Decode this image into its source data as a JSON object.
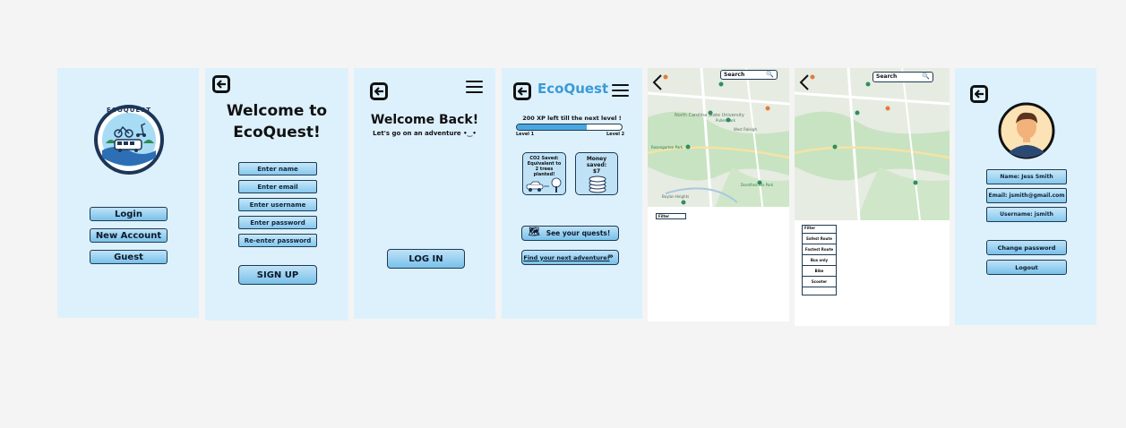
{
  "screen1": {
    "logo_text": "ECOQUEST",
    "buttons": [
      "Login",
      "New Account",
      "Guest"
    ]
  },
  "screen2": {
    "title_line1": "Welcome to",
    "title_line2": "EcoQuest!",
    "fields": [
      "Enter name",
      "Enter email",
      "Enter username",
      "Enter password",
      "Re-enter password"
    ],
    "signup": "SIGN UP"
  },
  "screen3": {
    "title": "Welcome Back!",
    "subtitle": "Let's go on an adventure •‿•",
    "login": "LOG IN"
  },
  "screen4": {
    "brand": "EcoQuest",
    "xp_text": "200 XP left till the next level !",
    "xp_progress": 0.67,
    "level_left": "Level 1",
    "level_right": "Level 2",
    "co2_card": "CO2 Saved: Equivalent to 2 trees planted!",
    "money_title": "Money saved:",
    "money_value": "$7",
    "quests_button": "See your quests!",
    "adventure_button": "Find your next adventure!"
  },
  "map5": {
    "search": "Search",
    "filter_label": "Filter",
    "map_labels": [
      "North Carolina State University",
      "Pullen Park",
      "Dorothea Dix Park",
      "Rosengarten Park",
      "West Raleigh",
      "Boylan Heights"
    ]
  },
  "map6": {
    "search": "Search",
    "filter_options": [
      "Filter",
      "Safest Route",
      "Fastest Route",
      "Bus only",
      "Bike",
      "Scooter"
    ]
  },
  "profile": {
    "name": "Name: Jess Smith",
    "email": "Email: jsmith@gmail.com",
    "username": "Username: jsmith",
    "change_password": "Change password",
    "logout": "Logout"
  },
  "colors": {
    "screen_bg": "#ddf1fd",
    "button_top": "#bfe2f7",
    "button_bottom": "#79c1ea",
    "brand": "#3b9ad6",
    "outline": "#1f3a52"
  }
}
